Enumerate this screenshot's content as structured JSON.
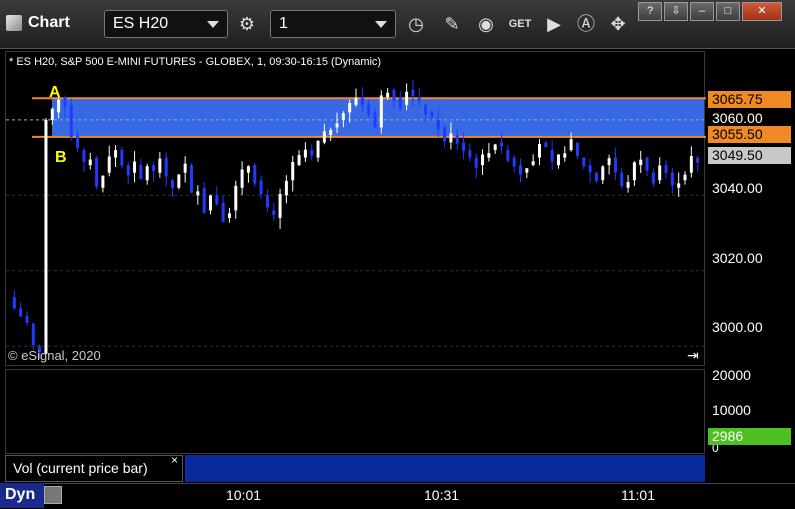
{
  "window": {
    "title": "Chart",
    "symbol": "ES H20",
    "interval": "1",
    "buttons": [
      "restore-icon",
      "minimize-icon",
      "maximize-icon",
      "close-icon"
    ]
  },
  "toolbar": {
    "icons": [
      "gear-icon",
      "clock-icon",
      "pencil-icon",
      "study-icon",
      "get-icon",
      "play-icon",
      "alert-icon",
      "cursor-icon"
    ],
    "get_label": "GET"
  },
  "chart": {
    "title": "* ES H20, S&P 500 E-MINI FUTURES - GLOBEX, 1, 09:30-16:15 (Dynamic)",
    "copyright": "© eSignal, 2020",
    "y_labels": [
      "3060.00",
      "3040.00",
      "3020.00",
      "3000.00"
    ],
    "price_tags": {
      "zone_top": "3065.75",
      "zone_bottom": "3055.50",
      "last": "3049.50"
    },
    "zone_labels": {
      "a": "A",
      "b": "B"
    },
    "volume_labels": [
      "20000",
      "10000",
      "0"
    ],
    "volume_tag": "2986",
    "x_labels": [
      "10:01",
      "10:31",
      "11:01"
    ]
  },
  "volume_pane": {
    "label": "Vol (current price bar)",
    "close": "×"
  },
  "footer": {
    "mode": "Dyn"
  },
  "colors": {
    "zone_fill": "#3b6ff0",
    "zone_line": "#f08a24",
    "up_bar": "#ffffff",
    "down_bar": "#1f3bff",
    "vol_up": "#3bd12e",
    "vol_down": "#d42a1a"
  },
  "chart_data": {
    "type": "candlestick",
    "title": "* ES H20, S&P 500 E-MINI FUTURES - GLOBEX, 1, 09:30-16:15 (Dynamic)",
    "y_range": [
      2995,
      3078
    ],
    "zone": {
      "top": 3065.75,
      "bottom": 3055.5
    },
    "last_price": 3049.5,
    "series": [
      {
        "name": "Vol (current price bar)",
        "values": [
          20000,
          2986
        ]
      }
    ]
  }
}
